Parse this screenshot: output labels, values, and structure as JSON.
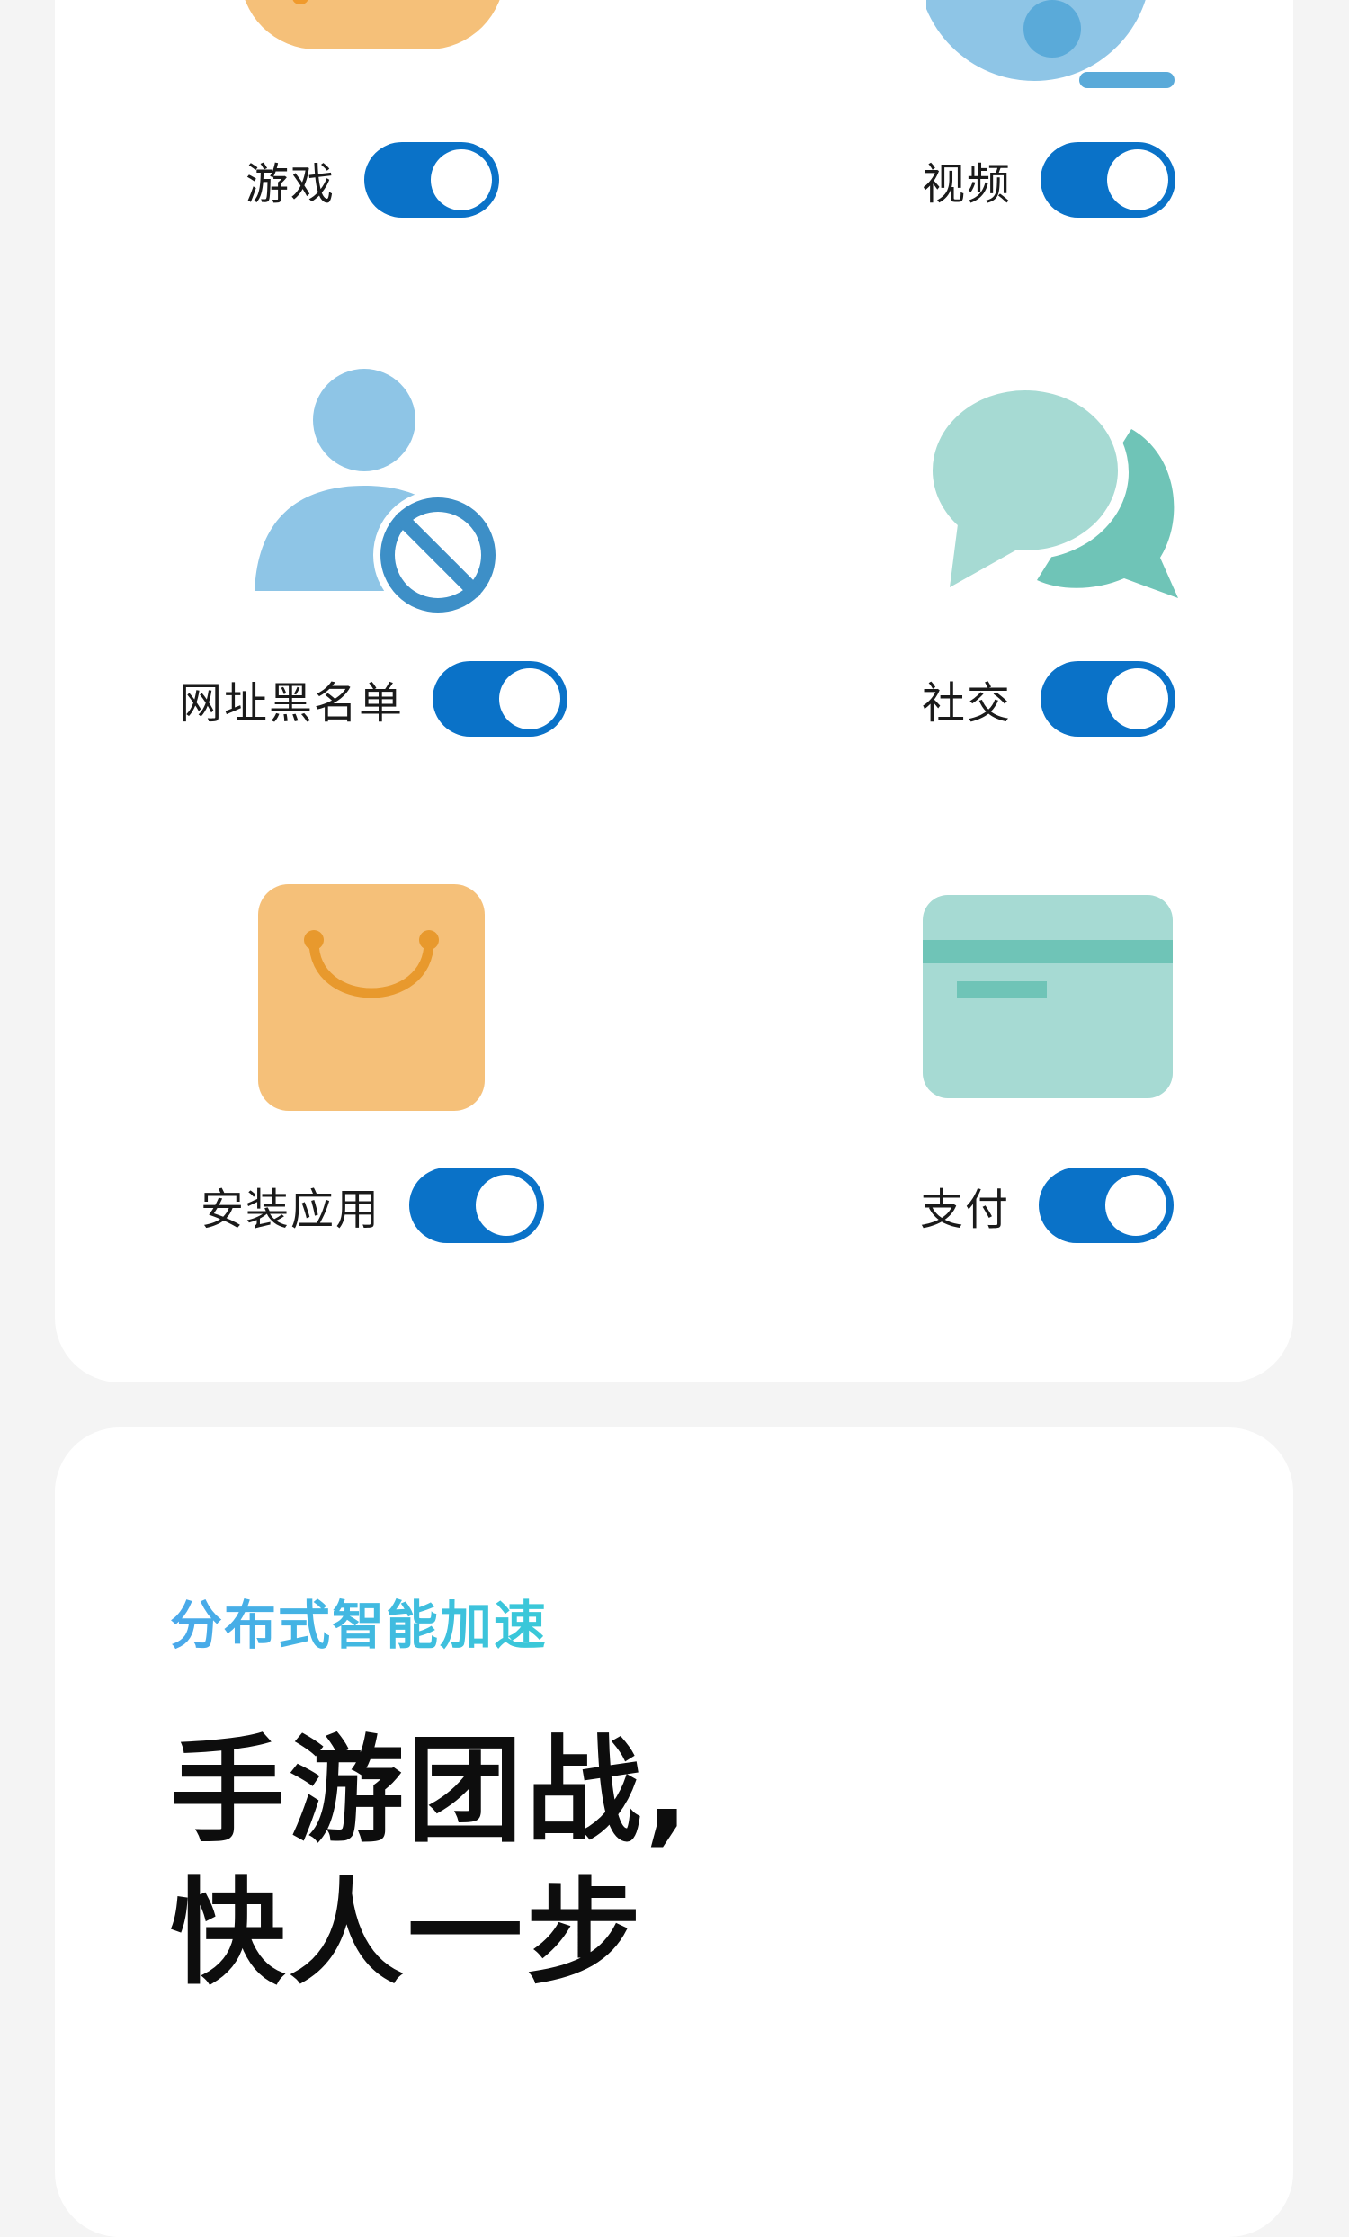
{
  "features": [
    {
      "label": "游戏",
      "icon": "gamepad-icon",
      "enabled": true
    },
    {
      "label": "视频",
      "icon": "video-reel-icon",
      "enabled": true
    },
    {
      "label": "网址黑名单",
      "icon": "blocked-user-icon",
      "enabled": true
    },
    {
      "label": "社交",
      "icon": "chat-bubbles-icon",
      "enabled": true
    },
    {
      "label": "安装应用",
      "icon": "shopping-bag-icon",
      "enabled": true
    },
    {
      "label": "支付",
      "icon": "credit-card-icon",
      "enabled": true
    }
  ],
  "promo": {
    "accent": "分布式智能加速",
    "headline_line1": "手游团战,",
    "headline_line2": "快人一步"
  },
  "colors": {
    "toggle_on": "#0a72c8",
    "orange": "#f5c079",
    "blue": "#8ec5e6",
    "teal": "#a6dad3"
  }
}
